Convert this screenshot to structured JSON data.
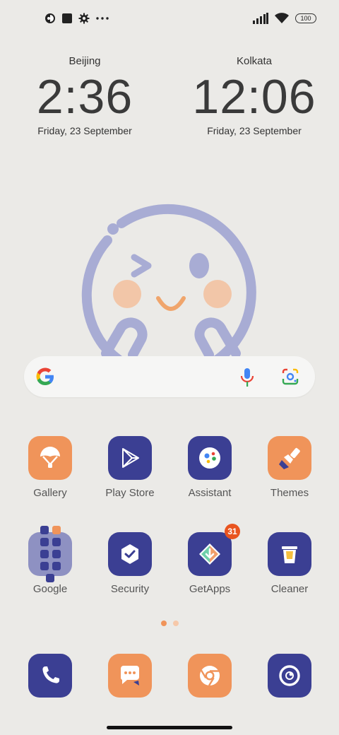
{
  "status_bar": {
    "left_icons": [
      "data-saver-icon",
      "stop-icon",
      "settings-gear-icon",
      "more-dots-icon"
    ],
    "right_icons": [
      "signal-icon",
      "wifi-icon"
    ],
    "battery": "100"
  },
  "clocks": [
    {
      "city": "Beijing",
      "time": "2:36",
      "date": "Friday, 23 September"
    },
    {
      "city": "Kolkata",
      "time": "12:06",
      "date": "Friday, 23 September"
    }
  ],
  "search": {
    "icons": [
      "google-g-icon",
      "microphone-icon",
      "lens-camera-icon"
    ]
  },
  "apps_row1": [
    {
      "label": "Gallery",
      "icon": "gallery-icon",
      "color": "#f0945a"
    },
    {
      "label": "Play Store",
      "icon": "play-store-icon",
      "color": "#3b3f93"
    },
    {
      "label": "Assistant",
      "icon": "assistant-icon",
      "color": "#3b3f93"
    },
    {
      "label": "Themes",
      "icon": "paintbrush-icon",
      "color": "#f0945a"
    }
  ],
  "apps_row2": [
    {
      "label": "Google",
      "icon": "folder-icon",
      "color": "#8e91c2"
    },
    {
      "label": "Security",
      "icon": "shield-check-icon",
      "color": "#3b3f93"
    },
    {
      "label": "GetApps",
      "icon": "getapps-icon",
      "color": "#3b3f93",
      "badge": "31"
    },
    {
      "label": "Cleaner",
      "icon": "trash-bin-icon",
      "color": "#3b3f93"
    }
  ],
  "dock": [
    {
      "icon": "phone-icon",
      "color": "#3b3f93"
    },
    {
      "icon": "messages-icon",
      "color": "#f0945a"
    },
    {
      "icon": "chrome-icon",
      "color": "#f0945a"
    },
    {
      "icon": "camera-icon",
      "color": "#3b3f93"
    }
  ],
  "pages": {
    "count": 2,
    "current": 1
  },
  "colors": {
    "accent_orange": "#f0945a",
    "accent_navy": "#3b3f93",
    "badge": "#e9541f",
    "background": "#ebeae7"
  }
}
